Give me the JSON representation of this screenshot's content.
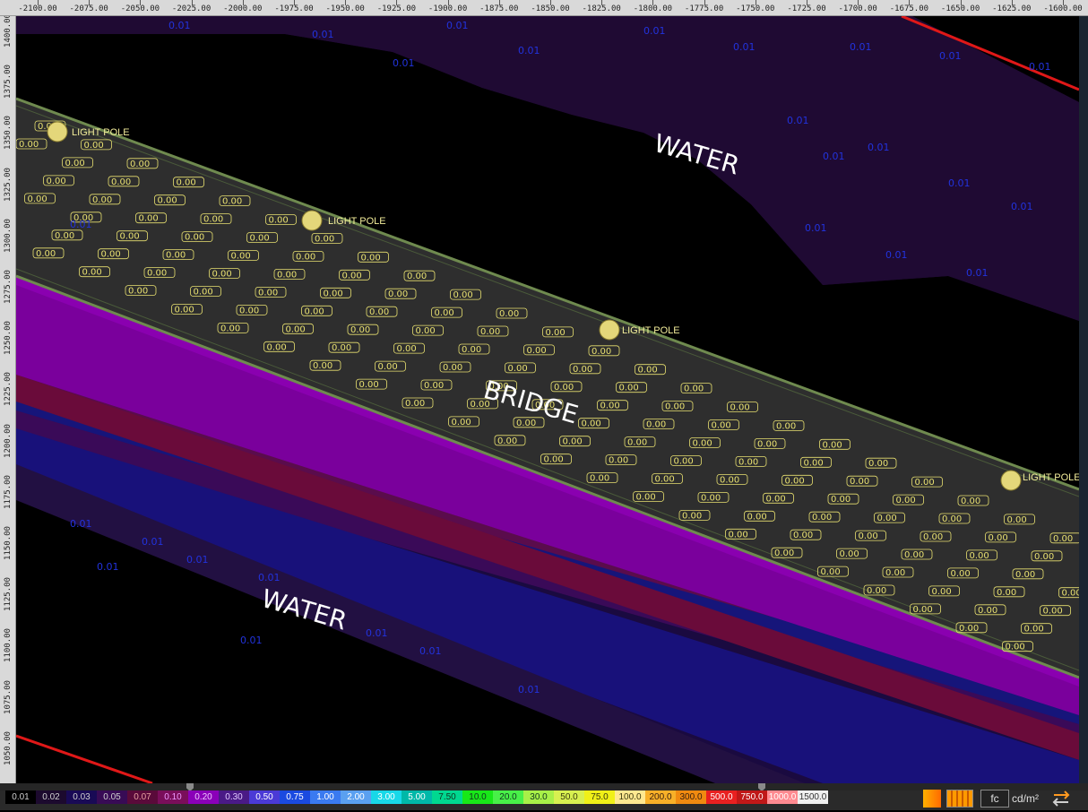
{
  "ruler_top": {
    "labels": [
      "-2100.00",
      "-2075.00",
      "-2050.00",
      "-2025.00",
      "-2000.00",
      "-1975.00",
      "-1950.00",
      "-1925.00",
      "-1900.00",
      "-1875.00",
      "-1850.00",
      "-1825.00",
      "-1800.00",
      "-1775.00",
      "-1750.00",
      "-1725.00",
      "-1700.00",
      "-1675.00",
      "-1650.00",
      "-1625.00",
      "-1600.00"
    ]
  },
  "ruler_left": {
    "labels": [
      "1400.00",
      "1375.00",
      "1350.00",
      "1325.00",
      "1300.00",
      "1275.00",
      "1250.00",
      "1225.00",
      "1200.00",
      "1175.00",
      "1150.00",
      "1125.00",
      "1100.00",
      "1075.00",
      "1050.00"
    ]
  },
  "areas": {
    "water_top": "WATER",
    "water_bottom": "WATER",
    "bridge": "BRIDGE"
  },
  "poles": {
    "label": "LIGHT POLE"
  },
  "calc_values": {
    "bridge_deck": "0.00",
    "water_near": "0.01"
  },
  "legend": {
    "swatches": [
      {
        "label": "0.01",
        "color": "#000000",
        "text": "#cfcfcf"
      },
      {
        "label": "0.02",
        "color": "#1c0a2e",
        "text": "#cfcfcf"
      },
      {
        "label": "0.03",
        "color": "#190a55",
        "text": "#cfcfcf"
      },
      {
        "label": "0.05",
        "color": "#380b55",
        "text": "#cfcfcf"
      },
      {
        "label": "0.07",
        "color": "#5a0a3a",
        "text": "#e6a0a0"
      },
      {
        "label": "0.10",
        "color": "#7a0e5a",
        "text": "#ee99ff"
      },
      {
        "label": "0.20",
        "color": "#8a00b8",
        "text": "#f0c8ff"
      },
      {
        "label": "0.30",
        "color": "#4a1a86",
        "text": "#e0c8ff"
      },
      {
        "label": "0.50",
        "color": "#4b3ad6",
        "text": "#ffffff"
      },
      {
        "label": "0.75",
        "color": "#1a4ae0",
        "text": "#ffffff"
      },
      {
        "label": "1.00",
        "color": "#3a7af0",
        "text": "#ffffff"
      },
      {
        "label": "2.00",
        "color": "#5aa0f0",
        "text": "#ffffff"
      },
      {
        "label": "3.00",
        "color": "#18d8e8",
        "text": "#ffffff"
      },
      {
        "label": "5.00",
        "color": "#00b8a8",
        "text": "#ffffff"
      },
      {
        "label": "7.50",
        "color": "#00d890",
        "text": "#10351f"
      },
      {
        "label": "10.0",
        "color": "#18e818",
        "text": "#10351f"
      },
      {
        "label": "20.0",
        "color": "#48f048",
        "text": "#10351f"
      },
      {
        "label": "30.0",
        "color": "#a8f048",
        "text": "#10351f"
      },
      {
        "label": "50.0",
        "color": "#d8f050",
        "text": "#3a3a10"
      },
      {
        "label": "75.0",
        "color": "#f0f018",
        "text": "#3a3a10"
      },
      {
        "label": "100.0",
        "color": "#ffe890",
        "text": "#3a3a10"
      },
      {
        "label": "200.0",
        "color": "#f8b028",
        "text": "#3a2010"
      },
      {
        "label": "300.0",
        "color": "#f08a10",
        "text": "#3a2010"
      },
      {
        "label": "500.0",
        "color": "#e82020",
        "text": "#ffffff"
      },
      {
        "label": "750.0",
        "color": "#c01818",
        "text": "#ffffff"
      },
      {
        "label": "1000.0",
        "color": "#ff8a90",
        "text": "#ffffff"
      },
      {
        "label": "1500.0",
        "color": "#f0f0f0",
        "text": "#333333"
      }
    ],
    "unit_fc": "fc",
    "unit_cd": "cd/m²"
  },
  "colors": {
    "water_dark": "#000000",
    "water_purple": "#1f0a33",
    "bridge_deck": "#2e2e2e",
    "pole_fill": "#e4d77a",
    "calc_blue": "#2233dd",
    "calc_yellow": "#e8e070",
    "boundary_red": "#e01818"
  }
}
